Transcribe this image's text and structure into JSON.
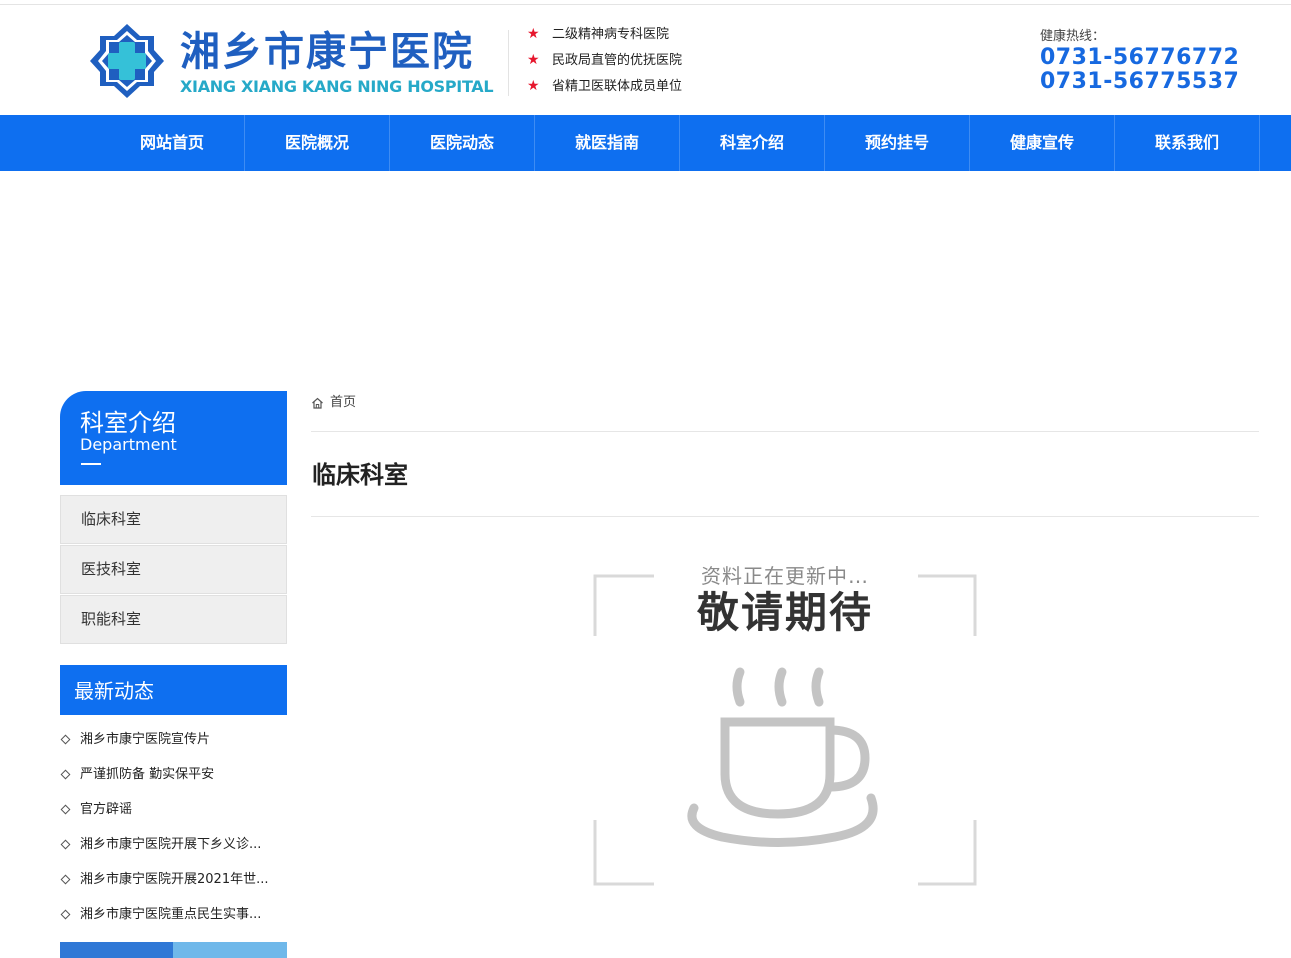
{
  "header": {
    "hospital_name_cn": "湘乡市康宁医院",
    "hospital_name_en": "XIANG XIANG KANG NING HOSPITAL",
    "tags": [
      "二级精神病专科医院",
      "民政局直管的优抚医院",
      "省精卫医联体成员单位"
    ],
    "hotline_label": "健康热线：",
    "hotline_numbers": [
      "0731-56776772",
      "0731-56775537"
    ],
    "colors": {
      "brand_blue": "#0e6ff0",
      "logo_blue": "#1f5fc0",
      "logo_teal": "#26a9c8",
      "star_red": "#e6162d"
    }
  },
  "nav": {
    "items": [
      "网站首页",
      "医院概况",
      "医院动态",
      "就医指南",
      "科室介绍",
      "预约挂号",
      "健康宣传",
      "联系我们"
    ]
  },
  "sidebar": {
    "title_cn": "科室介绍",
    "title_en": "Department",
    "links": [
      "临床科室",
      "医技科室",
      "职能科室"
    ],
    "news_title": "最新动态",
    "news": [
      "湘乡市康宁医院宣传片",
      "严谨抓防备 勤实保平安",
      "官方辟谣",
      "湘乡市康宁医院开展下乡义诊...",
      "湘乡市康宁医院开展2021年世...",
      "湘乡市康宁医院重点民生实事..."
    ]
  },
  "main": {
    "breadcrumb_home": "首页",
    "page_title": "临床科室",
    "placeholder_line1": "资料正在更新中…",
    "placeholder_line2": "敬请期待",
    "placeholder_icon": "coffee-cup-icon"
  }
}
